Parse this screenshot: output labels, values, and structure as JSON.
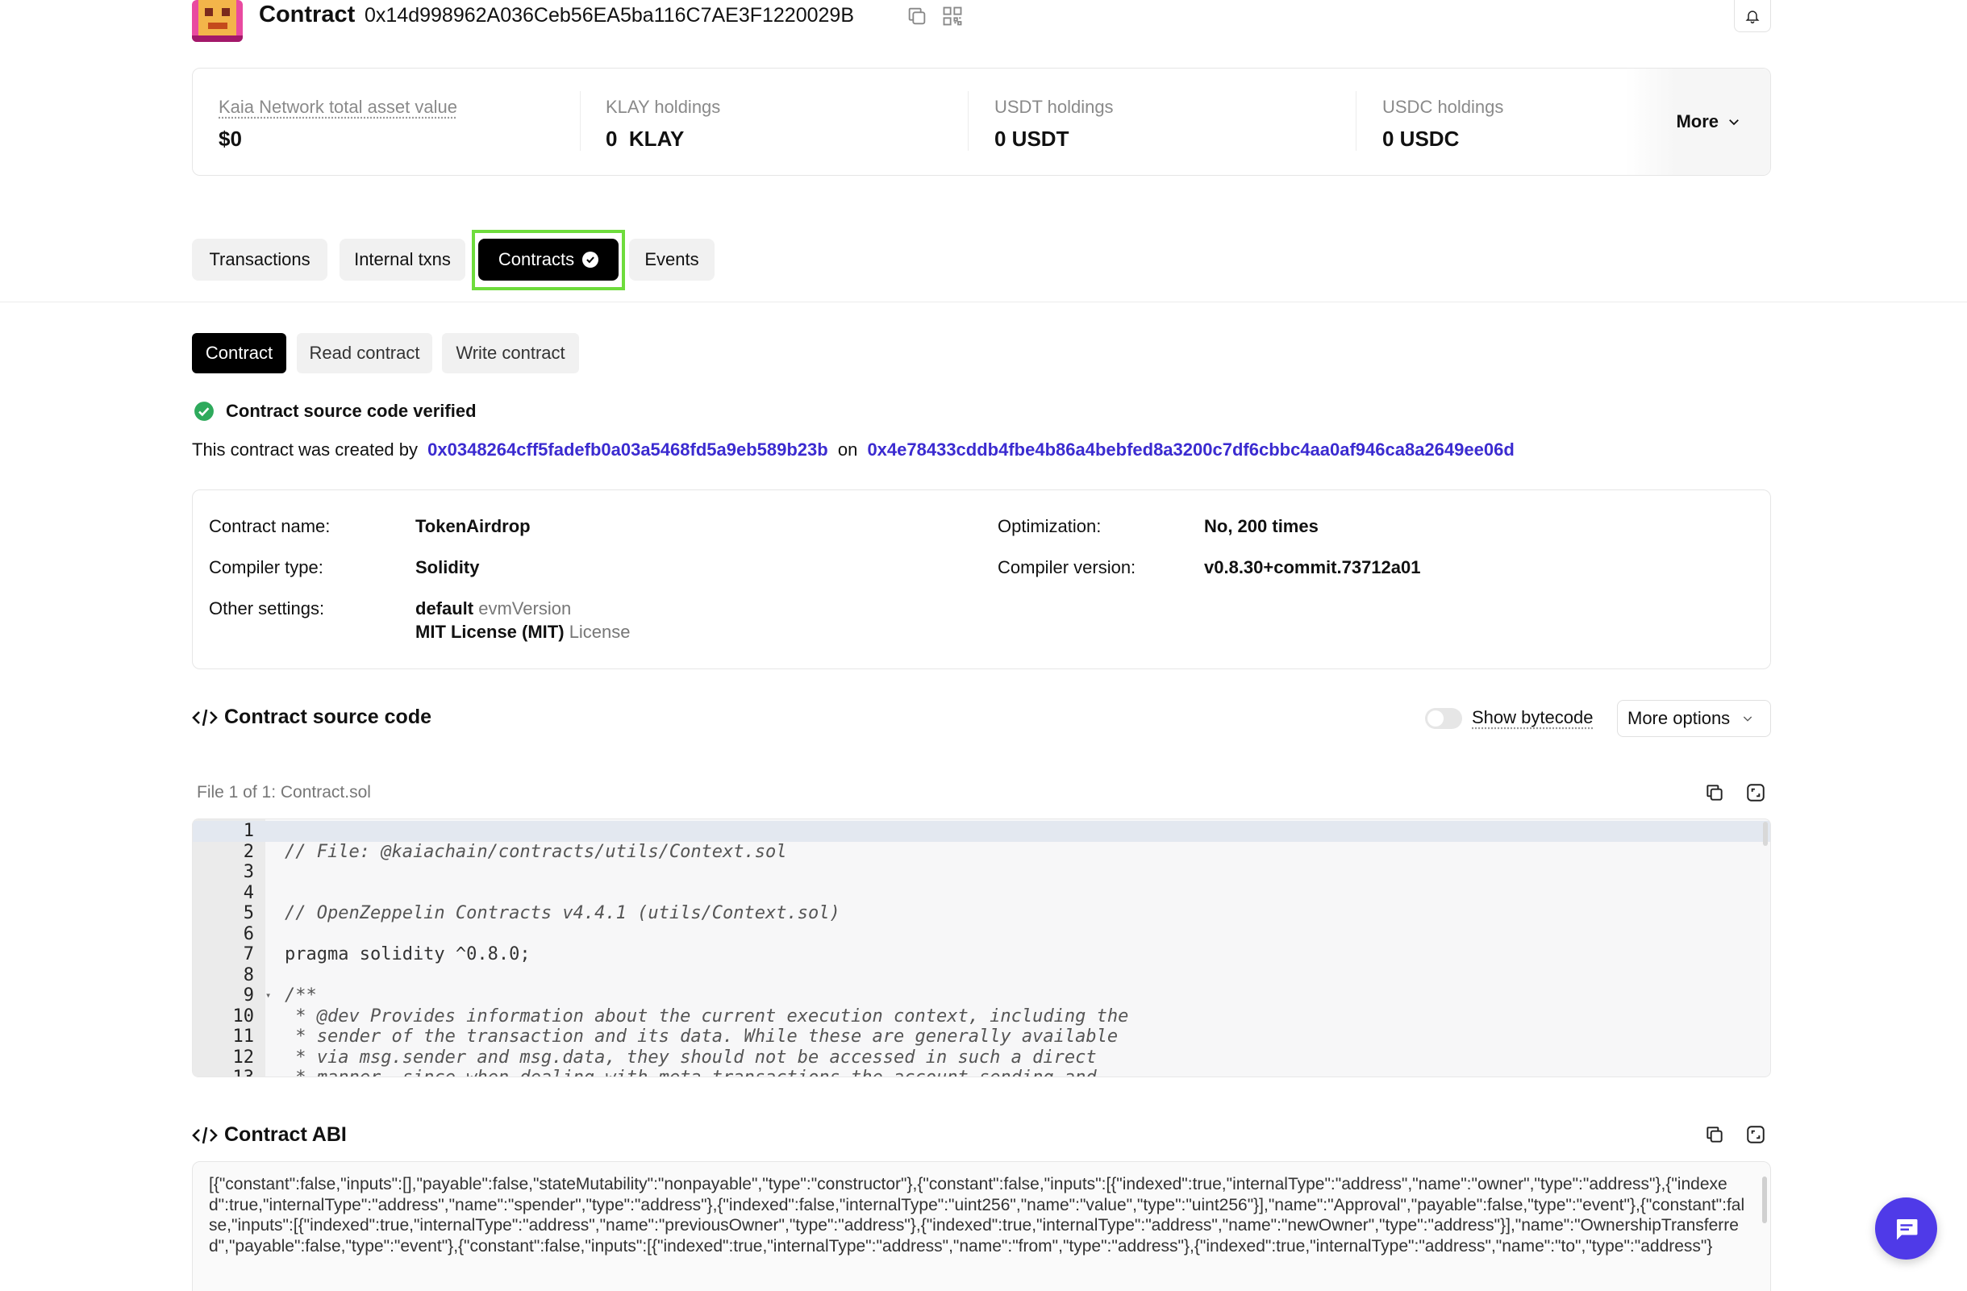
{
  "header": {
    "label": "Contract",
    "address": "0x14d998962A036Ceb56EA5ba116C7AE3F1220029B"
  },
  "holdings": {
    "items": [
      {
        "label": "Kaia Network total asset value",
        "value": "$0"
      },
      {
        "label": "KLAY holdings",
        "value": "0  KLAY"
      },
      {
        "label": "USDT holdings",
        "value": "0 USDT"
      },
      {
        "label": "USDC holdings",
        "value": "0 USDC"
      }
    ],
    "more_label": "More"
  },
  "tabs": [
    {
      "label": "Transactions"
    },
    {
      "label": "Internal txns"
    },
    {
      "label": "Contracts"
    },
    {
      "label": "Events"
    }
  ],
  "sub_tabs": [
    {
      "label": "Contract"
    },
    {
      "label": "Read contract"
    },
    {
      "label": "Write contract"
    }
  ],
  "verified_text": "Contract source code verified",
  "created": {
    "prefix": "This contract was created by",
    "creator": "0x0348264cff5fadefb0a03a5468fd5a9eb589b23b",
    "on": "on",
    "tx": "0x4e78433cddb4fbe4b86a4bebfed8a3200c7df6cbbc4aa0af946ca8a2649ee06d"
  },
  "info": {
    "contract_name_label": "Contract name:",
    "contract_name": "TokenAirdrop",
    "compiler_type_label": "Compiler type:",
    "compiler_type": "Solidity",
    "other_settings_label": "Other settings:",
    "evm_value": "default",
    "evm_suffix": "evmVersion",
    "license_value": "MIT License (MIT)",
    "license_suffix": "License",
    "optimization_label": "Optimization:",
    "optimization": "No, 200 times",
    "compiler_version_label": "Compiler version:",
    "compiler_version": "v0.8.30+commit.73712a01"
  },
  "source": {
    "title": "Contract source code",
    "show_bytecode": "Show bytecode",
    "more_options": "More options",
    "file_label": "File 1 of 1: Contract.sol",
    "lines": [
      {
        "n": "1",
        "text": ""
      },
      {
        "n": "2",
        "text": "// File: @kaiachain/contracts/utils/Context.sol"
      },
      {
        "n": "3",
        "text": ""
      },
      {
        "n": "4",
        "text": ""
      },
      {
        "n": "5",
        "text": "// OpenZeppelin Contracts v4.4.1 (utils/Context.sol)"
      },
      {
        "n": "6",
        "text": ""
      },
      {
        "n": "7",
        "text": "pragma solidity ^0.8.0;"
      },
      {
        "n": "8",
        "text": ""
      },
      {
        "n": "9",
        "text": "/**"
      },
      {
        "n": "10",
        "text": " * @dev Provides information about the current execution context, including the"
      },
      {
        "n": "11",
        "text": " * sender of the transaction and its data. While these are generally available"
      },
      {
        "n": "12",
        "text": " * via msg.sender and msg.data, they should not be accessed in such a direct"
      },
      {
        "n": "13",
        "text": " * manner, since when dealing with meta-transactions the account sending and"
      }
    ]
  },
  "abi": {
    "title": "Contract ABI",
    "text": "[{\"constant\":false,\"inputs\":[],\"payable\":false,\"stateMutability\":\"nonpayable\",\"type\":\"constructor\"},{\"constant\":false,\"inputs\":[{\"indexed\":true,\"internalType\":\"address\",\"name\":\"owner\",\"type\":\"address\"},{\"indexed\":true,\"internalType\":\"address\",\"name\":\"spender\",\"type\":\"address\"},{\"indexed\":false,\"internalType\":\"uint256\",\"name\":\"value\",\"type\":\"uint256\"}],\"name\":\"Approval\",\"payable\":false,\"type\":\"event\"},{\"constant\":false,\"inputs\":[{\"indexed\":true,\"internalType\":\"address\",\"name\":\"previousOwner\",\"type\":\"address\"},{\"indexed\":true,\"internalType\":\"address\",\"name\":\"newOwner\",\"type\":\"address\"}],\"name\":\"OwnershipTransferred\",\"payable\":false,\"type\":\"event\"},{\"constant\":false,\"inputs\":[{\"indexed\":true,\"internalType\":\"address\",\"name\":\"from\",\"type\":\"address\"},{\"indexed\":true,\"internalType\":\"address\",\"name\":\"to\",\"type\":\"address\"}"
  },
  "colors": {
    "accent": "#3b2bd0",
    "highlight": "#6edc3c",
    "verified": "#2eaa5c",
    "chat": "#4f3ae8"
  }
}
